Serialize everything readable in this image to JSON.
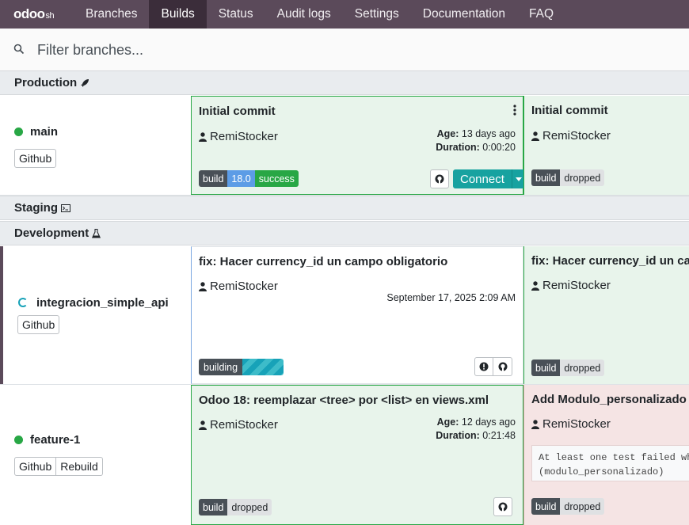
{
  "nav": {
    "logo": "odoo",
    "logo_suffix": "sh",
    "items": [
      "Branches",
      "Builds",
      "Status",
      "Audit logs",
      "Settings",
      "Documentation",
      "FAQ"
    ],
    "active": "Builds"
  },
  "search": {
    "placeholder": "Filter branches..."
  },
  "stages": {
    "production": {
      "label": "Production",
      "icon": "rocket-icon"
    },
    "staging": {
      "label": "Staging",
      "icon": "terminal-icon"
    },
    "development": {
      "label": "Development",
      "icon": "flask-icon"
    }
  },
  "rows": [
    {
      "branch": "main",
      "status": "green",
      "buttons": [
        "Github"
      ],
      "builds": [
        {
          "title": "Initial commit",
          "author": "RemiStocker",
          "age_label": "Age:",
          "age": "13 days ago",
          "duration_label": "Duration:",
          "duration": "0:00:20",
          "badge_type": "build",
          "badge_version": "18.0",
          "badge_status": "success",
          "connect": "Connect"
        },
        {
          "title": "Initial commit",
          "author": "RemiStocker",
          "badge_type": "build",
          "badge_status": "dropped"
        }
      ]
    },
    {
      "branch": "integracion_simple_api",
      "status": "building",
      "buttons": [
        "Github"
      ],
      "builds": [
        {
          "title": "fix: Hacer currency_id un campo obligatorio",
          "author": "RemiStocker",
          "date": "September 17, 2025 2:09 AM",
          "badge_status": "building"
        },
        {
          "title": "fix: Hacer currency_id un cam",
          "author": "RemiStocker",
          "badge_type": "build",
          "badge_status": "dropped"
        }
      ]
    },
    {
      "branch": "feature-1",
      "status": "green",
      "buttons": [
        "Github",
        "Rebuild"
      ],
      "builds": [
        {
          "title": "Odoo 18: reemplazar <tree> por <list> en views.xml",
          "author": "RemiStocker",
          "age_label": "Age:",
          "age": "12 days ago",
          "duration_label": "Duration:",
          "duration": "0:21:48",
          "badge_type": "build",
          "badge_status": "dropped"
        },
        {
          "title": "Add Modulo_personalizado s",
          "author": "RemiStocker",
          "log_line1": "At least one test failed whe",
          "log_line2": "(modulo_personalizado)",
          "badge_type": "build",
          "badge_status": "dropped"
        }
      ]
    }
  ],
  "colors": {
    "nav_bg": "#5b4a5a",
    "nav_active": "#3b2d3a",
    "success": "#28a745",
    "version": "#5c9ce6",
    "connect": "#17a2a0",
    "failed_bg": "#f5e4e4"
  }
}
